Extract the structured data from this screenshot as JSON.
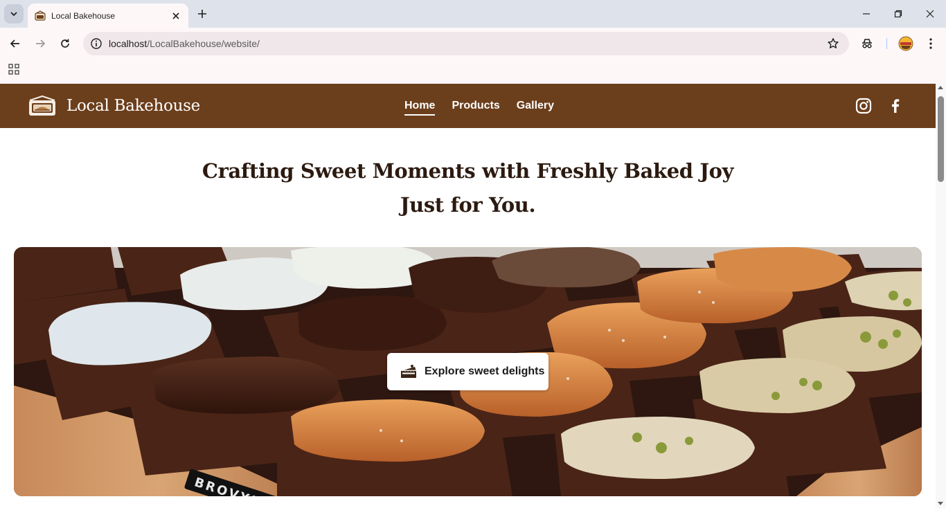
{
  "browser": {
    "tab_title": "Local Bakehouse",
    "url_host": "localhost",
    "url_path": "/LocalBakehouse/website/"
  },
  "site": {
    "brand_name": "Local Bakehouse",
    "nav": [
      {
        "label": "Home",
        "active": true
      },
      {
        "label": "Products",
        "active": false
      },
      {
        "label": "Gallery",
        "active": false
      }
    ],
    "social": [
      "instagram-icon",
      "facebook-icon"
    ],
    "header_color": "#6b3e1c"
  },
  "hero": {
    "title_line1": "Crafting Sweet Moments with Freshly Baked Joy",
    "title_line2": "Just for You.",
    "cta_label": "Explore sweet delights",
    "image_label": "BROVYN"
  }
}
